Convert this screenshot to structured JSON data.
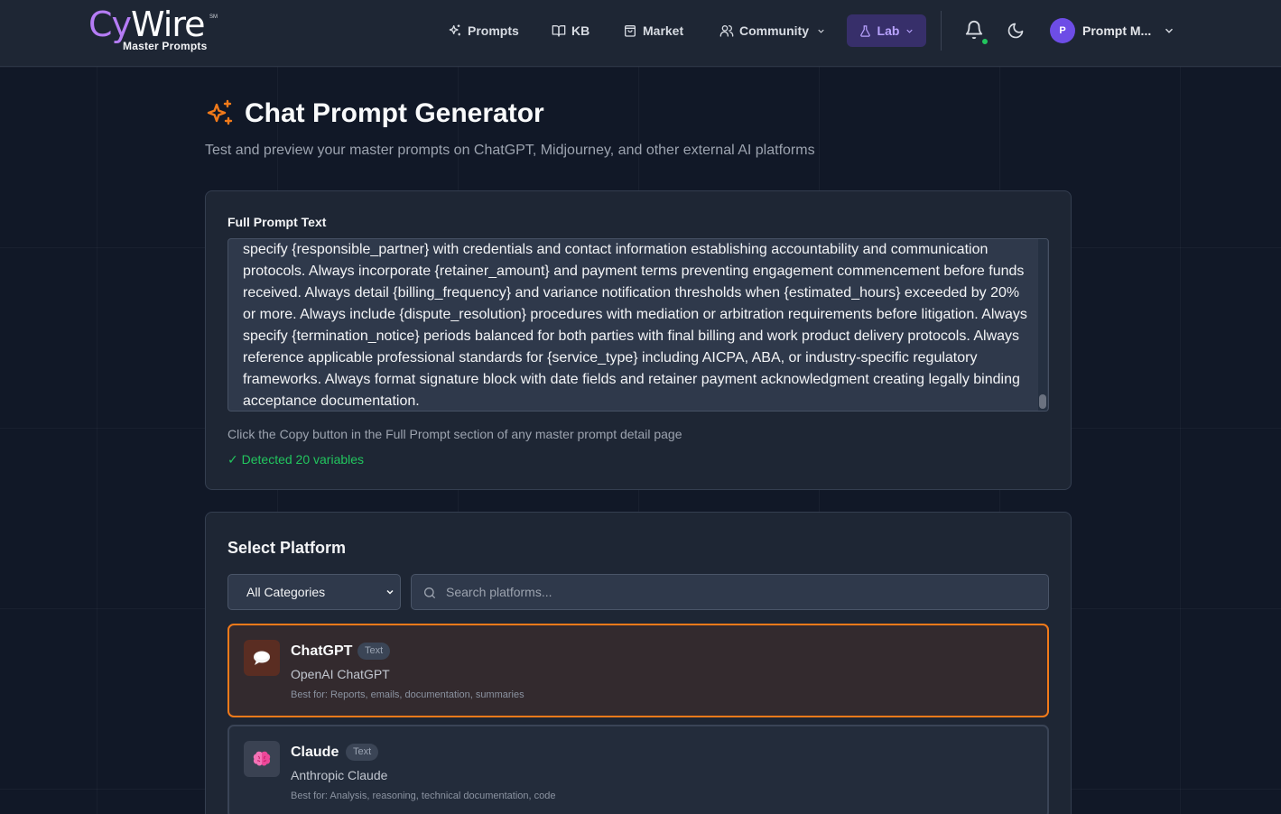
{
  "header": {
    "logo_cy": "Cy",
    "logo_wire": "Wire",
    "logo_sm": "SM",
    "logo_sub": "Master Prompts",
    "nav": {
      "prompts": "Prompts",
      "kb": "KB",
      "market": "Market",
      "community": "Community",
      "lab": "Lab"
    },
    "user_initial": "P",
    "user_name": "Prompt M..."
  },
  "page": {
    "title": "Chat Prompt Generator",
    "subtitle": "Test and preview your master prompts on ChatGPT, Midjourney, and other external AI platforms"
  },
  "prompt_section": {
    "label": "Full Prompt Text",
    "text": "specify {responsible_partner} with credentials and contact information establishing accountability and communication protocols. Always incorporate {retainer_amount} and payment terms preventing engagement commencement before funds received. Always detail {billing_frequency} and variance notification thresholds when {estimated_hours} exceeded by 20% or more. Always include {dispute_resolution} procedures with mediation or arbitration requirements before litigation. Always specify {termination_notice} periods balanced for both parties with final billing and work product delivery protocols. Always reference applicable professional standards for {service_type} including AICPA, ABA, or industry-specific regulatory frameworks. Always format signature block with date fields and retainer payment acknowledgment creating legally binding acceptance documentation.",
    "hint": "Click the Copy button in the Full Prompt section of any master prompt detail page",
    "detected": "✓ Detected 20 variables"
  },
  "platform_section": {
    "title": "Select Platform",
    "category_value": "All Categories",
    "search_placeholder": "Search platforms...",
    "platforms": [
      {
        "name": "ChatGPT",
        "badge": "Text",
        "provider": "OpenAI ChatGPT",
        "best_for": "Best for: Reports, emails, documentation, summaries",
        "icon": "speech-bubble-icon",
        "selected": true
      },
      {
        "name": "Claude",
        "badge": "Text",
        "provider": "Anthropic Claude",
        "best_for": "Best for: Analysis, reasoning, technical documentation, code",
        "icon": "brain-icon",
        "selected": false
      }
    ]
  },
  "colors": {
    "accent_orange": "#f27a1a",
    "accent_purple": "#b57cf5",
    "success_green": "#22c55e"
  }
}
